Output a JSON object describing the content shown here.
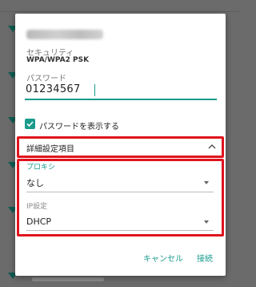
{
  "dialog": {
    "security_label": "セキュリティ",
    "security_value": "WPA/WPA2 PSK",
    "password_label": "パスワード",
    "password_value": "01234567",
    "show_password_label": "パスワードを表示する",
    "show_password_checked": true,
    "advanced_label": "詳細設定項目",
    "proxy": {
      "label": "プロキシ",
      "value": "なし"
    },
    "ip": {
      "label": "IP設定",
      "value": "DHCP"
    },
    "buttons": {
      "cancel": "キャンセル",
      "connect": "接続"
    }
  },
  "colors": {
    "accent": "#1a9b8c",
    "highlight_box": "#e0141e",
    "overlay": "#6b6b6b"
  },
  "icons": {
    "checkbox": "check-icon",
    "collapse": "chevron-up-icon",
    "dropdown": "dropdown-arrow-icon",
    "wifi": "wifi-icon"
  }
}
